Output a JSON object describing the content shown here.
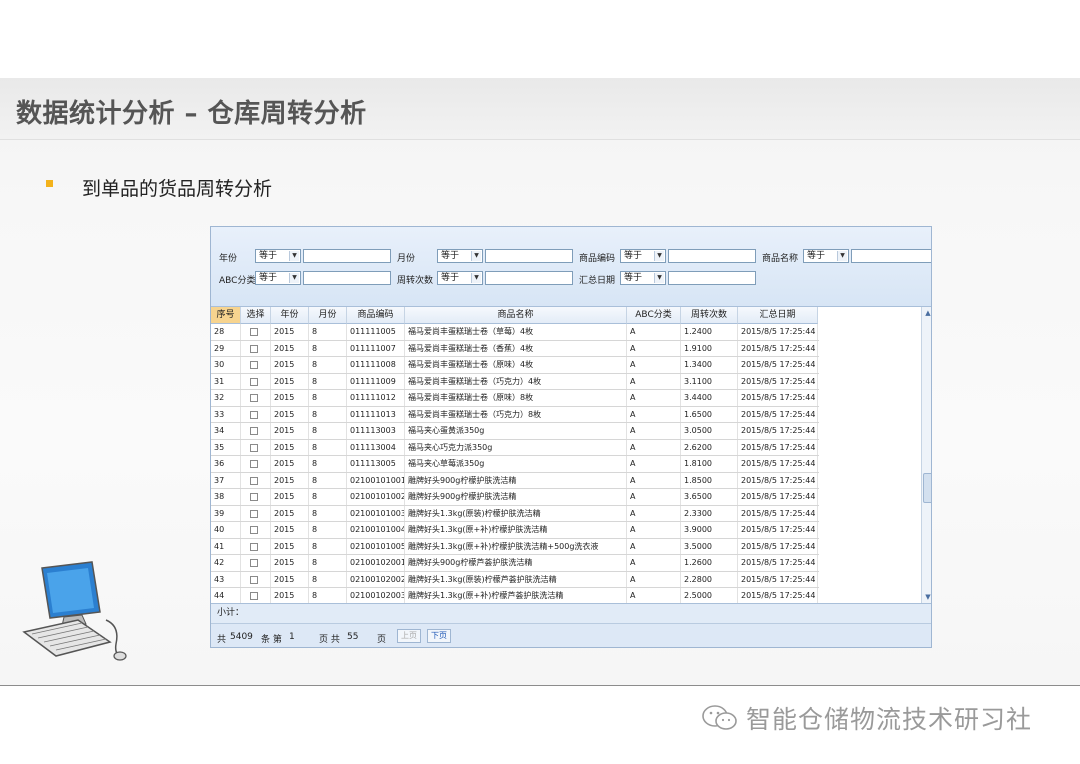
{
  "slide": {
    "title": "数据统计分析 – 仓库周转分析",
    "bullet": "到单品的货品周转分析",
    "watermark": "智能仓储物流技术研习社"
  },
  "filters": {
    "operator_default": "等于",
    "year_label": "年份",
    "month_label": "月份",
    "code_label": "商品编码",
    "name_label": "商品名称",
    "abc_label": "ABC分类",
    "turnover_label": "周转次数",
    "date_label": "汇总日期"
  },
  "table": {
    "columns": [
      "序号",
      "选择",
      "年份",
      "月份",
      "商品编码",
      "商品名称",
      "ABC分类",
      "周转次数",
      "汇总日期"
    ],
    "rows": [
      [
        "28",
        "",
        "2015",
        "8",
        "011111005",
        "福马爱尚丰蛋糕瑞士卷（草莓）4枚",
        "A",
        "1.2400",
        "2015/8/5 17:25:44"
      ],
      [
        "29",
        "",
        "2015",
        "8",
        "011111007",
        "福马爱尚丰蛋糕瑞士卷（香蕉）4枚",
        "A",
        "1.9100",
        "2015/8/5 17:25:44"
      ],
      [
        "30",
        "",
        "2015",
        "8",
        "011111008",
        "福马爱尚丰蛋糕瑞士卷（原味）4枚",
        "A",
        "1.3400",
        "2015/8/5 17:25:44"
      ],
      [
        "31",
        "",
        "2015",
        "8",
        "011111009",
        "福马爱尚丰蛋糕瑞士卷（巧克力）4枚",
        "A",
        "3.1100",
        "2015/8/5 17:25:44"
      ],
      [
        "32",
        "",
        "2015",
        "8",
        "011111012",
        "福马爱尚丰蛋糕瑞士卷（原味）8枚",
        "A",
        "3.4400",
        "2015/8/5 17:25:44"
      ],
      [
        "33",
        "",
        "2015",
        "8",
        "011111013",
        "福马爱尚丰蛋糕瑞士卷（巧克力）8枚",
        "A",
        "1.6500",
        "2015/8/5 17:25:44"
      ],
      [
        "34",
        "",
        "2015",
        "8",
        "011113003",
        "福马夹心蛋黄派350g",
        "A",
        "3.0500",
        "2015/8/5 17:25:44"
      ],
      [
        "35",
        "",
        "2015",
        "8",
        "011113004",
        "福马夹心巧克力派350g",
        "A",
        "2.6200",
        "2015/8/5 17:25:44"
      ],
      [
        "36",
        "",
        "2015",
        "8",
        "011113005",
        "福马夹心草莓派350g",
        "A",
        "1.8100",
        "2015/8/5 17:25:44"
      ],
      [
        "37",
        "",
        "2015",
        "8",
        "02100101001",
        "雕牌好头900g柠檬护肤洗洁精",
        "A",
        "1.8500",
        "2015/8/5 17:25:44"
      ],
      [
        "38",
        "",
        "2015",
        "8",
        "02100101002",
        "雕牌好头900g柠檬护肤洗洁精",
        "A",
        "3.6500",
        "2015/8/5 17:25:44"
      ],
      [
        "39",
        "",
        "2015",
        "8",
        "02100101003",
        "雕牌好头1.3kg(原装)柠檬护肤洗洁精",
        "A",
        "2.3300",
        "2015/8/5 17:25:44"
      ],
      [
        "40",
        "",
        "2015",
        "8",
        "02100101004",
        "雕牌好头1.3kg(原+补)柠檬护肤洗洁精",
        "A",
        "3.9000",
        "2015/8/5 17:25:44"
      ],
      [
        "41",
        "",
        "2015",
        "8",
        "02100101005",
        "雕牌好头1.3kg(原+补)柠檬护肤洗洁精+500g洗衣液",
        "A",
        "3.5000",
        "2015/8/5 17:25:44"
      ],
      [
        "42",
        "",
        "2015",
        "8",
        "02100102001",
        "雕牌好头900g柠檬芦荟护肤洗洁精",
        "A",
        "1.2600",
        "2015/8/5 17:25:44"
      ],
      [
        "43",
        "",
        "2015",
        "8",
        "02100102002",
        "雕牌好头1.3kg(原装)柠檬芦荟护肤洗洁精",
        "A",
        "2.2800",
        "2015/8/5 17:25:44"
      ],
      [
        "44",
        "",
        "2015",
        "8",
        "02100102003",
        "雕牌好头1.3kg(原+补)柠檬芦荟护肤洗洁精",
        "A",
        "2.5000",
        "2015/8/5 17:25:44"
      ]
    ]
  },
  "footer": {
    "subtotal_label": "小计：",
    "total_prefix": "共",
    "total_count": "5409",
    "total_suffix": "条 第",
    "page_current": "1",
    "page_mid": "页 共",
    "page_total": "55",
    "page_suffix": "页",
    "prev_label": "上页",
    "next_label": "下页"
  }
}
